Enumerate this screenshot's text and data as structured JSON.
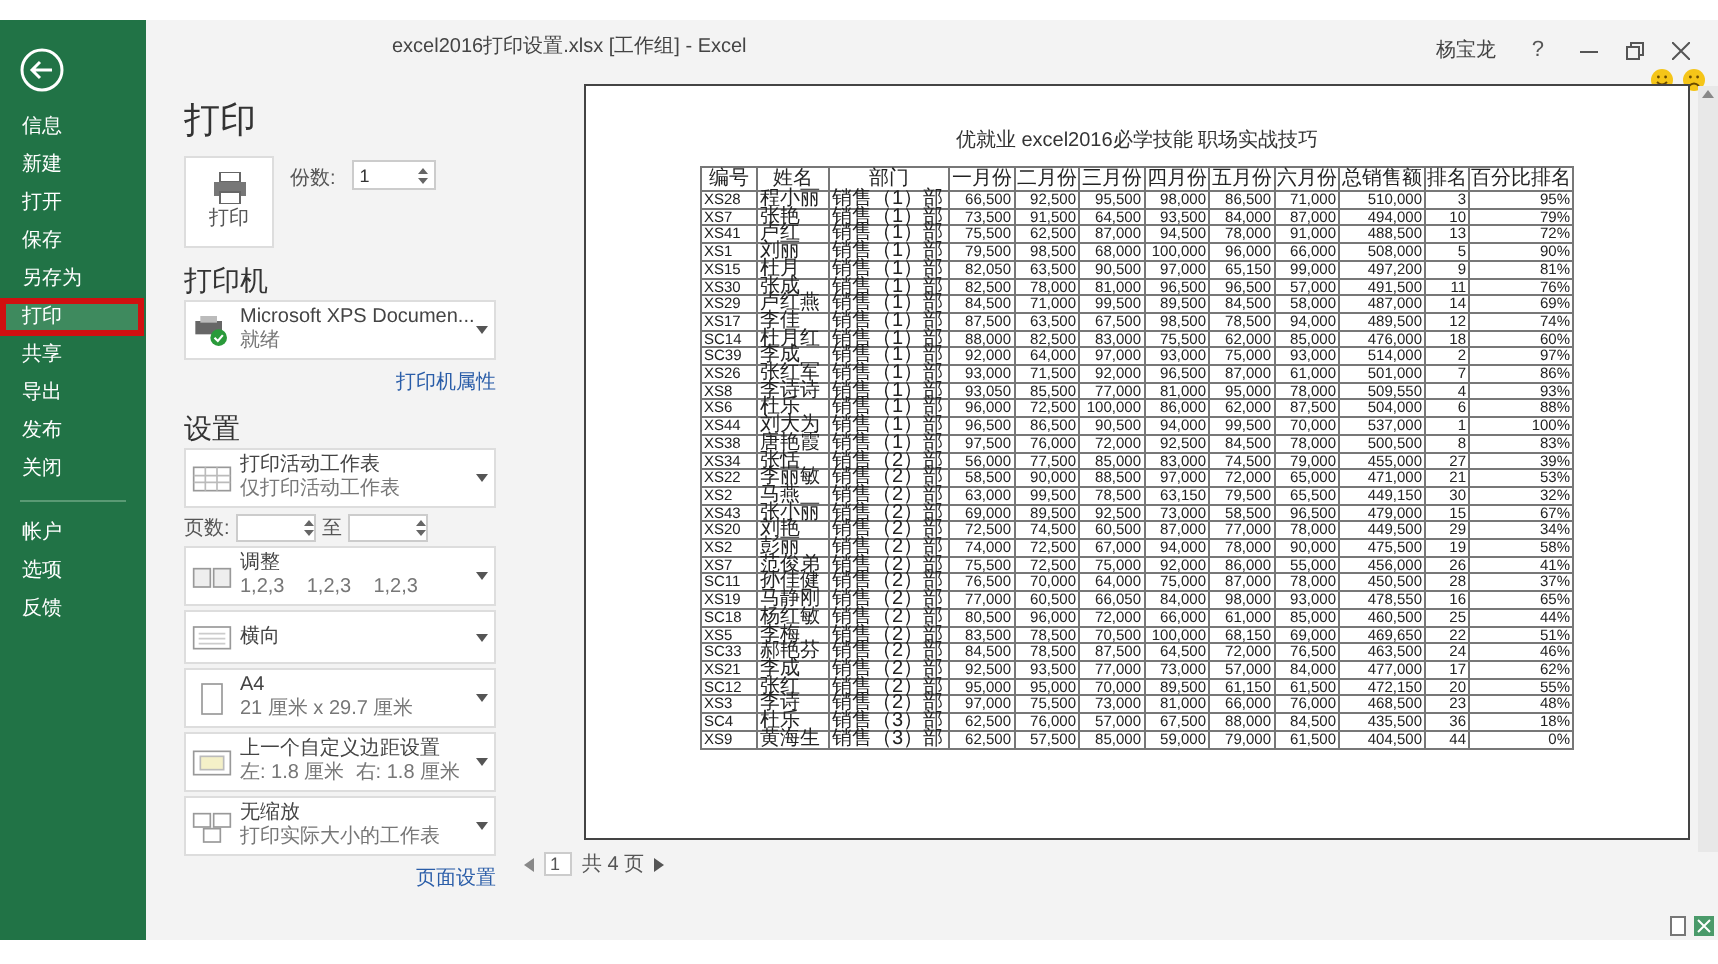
{
  "window": {
    "title": "excel2016打印设置.xlsx  [工作组] - Excel",
    "user": "杨宝龙",
    "help": "?"
  },
  "sidebar": {
    "items": [
      {
        "label": "信息",
        "selected": false
      },
      {
        "label": "新建",
        "selected": false
      },
      {
        "label": "打开",
        "selected": false
      },
      {
        "label": "保存",
        "selected": false
      },
      {
        "label": "另存为",
        "selected": false
      },
      {
        "label": "打印",
        "selected": true
      },
      {
        "label": "共享",
        "selected": false
      },
      {
        "label": "导出",
        "selected": false
      },
      {
        "label": "发布",
        "selected": false
      },
      {
        "label": "关闭",
        "selected": false
      }
    ],
    "footer_items": [
      {
        "label": "帐户",
        "selected": false
      },
      {
        "label": "选项",
        "selected": false
      },
      {
        "label": "反馈",
        "selected": false
      }
    ]
  },
  "print": {
    "heading": "打印",
    "print_button": "打印",
    "copies_label": "份数:",
    "copies": "1"
  },
  "printer": {
    "heading": "打印机",
    "name": "Microsoft XPS Documen...",
    "status": "就绪",
    "properties_link": "打印机属性"
  },
  "settings": {
    "heading": "设置",
    "options": [
      {
        "kind": "sheets",
        "title": "打印活动工作表",
        "subtitle": "仅打印活动工作表"
      },
      {
        "kind": "pages",
        "label": "页数:",
        "to_label": "至"
      },
      {
        "kind": "collate",
        "title": "调整",
        "subtitle": "1,2,3    1,2,3    1,2,3"
      },
      {
        "kind": "orientation",
        "title": "横向"
      },
      {
        "kind": "paper",
        "title": "A4",
        "subtitle": "21 厘米 x 29.7 厘米"
      },
      {
        "kind": "margins",
        "title": "上一个自定义边距设置",
        "subtitle": "左: 1.8 厘米  右: 1.8 厘米"
      },
      {
        "kind": "scaling",
        "title": "无缩放",
        "subtitle": "打印实际大小的工作表"
      }
    ],
    "page_setup_link": "页面设置"
  },
  "preview": {
    "title": "优就业 excel2016必学技能 职场实战技巧",
    "table": {
      "columns": [
        "编号",
        "姓名",
        "部门",
        "一月份",
        "二月份",
        "三月份",
        "四月份",
        "五月份",
        "六月份",
        "总销售额",
        "排名",
        "百分比排名"
      ],
      "rows": [
        [
          "XS28",
          "程小丽",
          "销售（1）部",
          "66,500",
          "92,500",
          "95,500",
          "98,000",
          "86,500",
          "71,000",
          "510,000",
          "3",
          "95%"
        ],
        [
          "XS7",
          "张艳",
          "销售（1）部",
          "73,500",
          "91,500",
          "64,500",
          "93,500",
          "84,000",
          "87,000",
          "494,000",
          "10",
          "79%"
        ],
        [
          "XS41",
          "卢红",
          "销售（1）部",
          "75,500",
          "62,500",
          "87,000",
          "94,500",
          "78,000",
          "91,000",
          "488,500",
          "13",
          "72%"
        ],
        [
          "XS1",
          "刘丽",
          "销售（1）部",
          "79,500",
          "98,500",
          "68,000",
          "100,000",
          "96,000",
          "66,000",
          "508,000",
          "5",
          "90%"
        ],
        [
          "XS15",
          "杜月",
          "销售（1）部",
          "82,050",
          "63,500",
          "90,500",
          "97,000",
          "65,150",
          "99,000",
          "497,200",
          "9",
          "81%"
        ],
        [
          "XS30",
          "张成",
          "销售（1）部",
          "82,500",
          "78,000",
          "81,000",
          "96,500",
          "96,500",
          "57,000",
          "491,500",
          "11",
          "76%"
        ],
        [
          "XS29",
          "卢红燕",
          "销售（1）部",
          "84,500",
          "71,000",
          "99,500",
          "89,500",
          "84,500",
          "58,000",
          "487,000",
          "14",
          "69%"
        ],
        [
          "XS17",
          "李佳",
          "销售（1）部",
          "87,500",
          "63,500",
          "67,500",
          "98,500",
          "78,500",
          "94,000",
          "489,500",
          "12",
          "74%"
        ],
        [
          "SC14",
          "杜月红",
          "销售（1）部",
          "88,000",
          "82,500",
          "83,000",
          "75,500",
          "62,000",
          "85,000",
          "476,000",
          "18",
          "60%"
        ],
        [
          "SC39",
          "李成",
          "销售（1）部",
          "92,000",
          "64,000",
          "97,000",
          "93,000",
          "75,000",
          "93,000",
          "514,000",
          "2",
          "97%"
        ],
        [
          "XS26",
          "张红军",
          "销售（1）部",
          "93,000",
          "71,500",
          "92,000",
          "96,500",
          "87,000",
          "61,000",
          "501,000",
          "7",
          "86%"
        ],
        [
          "XS8",
          "李诗诗",
          "销售（1）部",
          "93,050",
          "85,500",
          "77,000",
          "81,000",
          "95,000",
          "78,000",
          "509,550",
          "4",
          "93%"
        ],
        [
          "XS6",
          "杜乐",
          "销售（1）部",
          "96,000",
          "72,500",
          "100,000",
          "86,000",
          "62,000",
          "87,500",
          "504,000",
          "6",
          "88%"
        ],
        [
          "XS44",
          "刘大为",
          "销售（1）部",
          "96,500",
          "86,500",
          "90,500",
          "94,000",
          "99,500",
          "70,000",
          "537,000",
          "1",
          "100%"
        ],
        [
          "XS38",
          "唐艳霞",
          "销售（1）部",
          "97,500",
          "76,000",
          "72,000",
          "92,500",
          "84,500",
          "78,000",
          "500,500",
          "8",
          "83%"
        ],
        [
          "XS34",
          "张恬",
          "销售（2）部",
          "56,000",
          "77,500",
          "85,000",
          "83,000",
          "74,500",
          "79,000",
          "455,000",
          "27",
          "39%"
        ],
        [
          "XS22",
          "李丽敏",
          "销售（2）部",
          "58,500",
          "90,000",
          "88,500",
          "97,000",
          "72,000",
          "65,000",
          "471,000",
          "21",
          "53%"
        ],
        [
          "XS2",
          "马燕",
          "销售（2）部",
          "63,000",
          "99,500",
          "78,500",
          "63,150",
          "79,500",
          "65,500",
          "449,150",
          "30",
          "32%"
        ],
        [
          "XS43",
          "张小丽",
          "销售（2）部",
          "69,000",
          "89,500",
          "92,500",
          "73,000",
          "58,500",
          "96,500",
          "479,000",
          "15",
          "67%"
        ],
        [
          "XS20",
          "刘艳",
          "销售（2）部",
          "72,500",
          "74,500",
          "60,500",
          "87,000",
          "77,000",
          "78,000",
          "449,500",
          "29",
          "34%"
        ],
        [
          "XS2",
          "彭丽",
          "销售（2）部",
          "74,000",
          "72,500",
          "67,000",
          "94,000",
          "78,000",
          "90,000",
          "475,500",
          "19",
          "58%"
        ],
        [
          "XS7",
          "范俊弟",
          "销售（2）部",
          "75,500",
          "72,500",
          "75,000",
          "92,000",
          "86,000",
          "55,000",
          "456,000",
          "26",
          "41%"
        ],
        [
          "SC11",
          "孙佳健",
          "销售（2）部",
          "76,500",
          "70,000",
          "64,000",
          "75,000",
          "87,000",
          "78,000",
          "450,500",
          "28",
          "37%"
        ],
        [
          "XS19",
          "马静刚",
          "销售（2）部",
          "77,000",
          "60,500",
          "66,050",
          "84,000",
          "98,000",
          "93,000",
          "478,550",
          "16",
          "65%"
        ],
        [
          "SC18",
          "杨红敏",
          "销售（2）部",
          "80,500",
          "96,000",
          "72,000",
          "66,000",
          "61,000",
          "85,000",
          "460,500",
          "25",
          "44%"
        ],
        [
          "XS5",
          "李梅",
          "销售（2）部",
          "83,500",
          "78,500",
          "70,500",
          "100,000",
          "68,150",
          "69,000",
          "469,650",
          "22",
          "51%"
        ],
        [
          "SC33",
          "郝艳芬",
          "销售（2）部",
          "84,500",
          "78,500",
          "87,500",
          "64,500",
          "72,000",
          "76,500",
          "463,500",
          "24",
          "46%"
        ],
        [
          "XS21",
          "李成",
          "销售（2）部",
          "92,500",
          "93,500",
          "77,000",
          "73,000",
          "57,000",
          "84,000",
          "477,000",
          "17",
          "62%"
        ],
        [
          "SC12",
          "张红",
          "销售（2）部",
          "95,000",
          "95,000",
          "70,000",
          "89,500",
          "61,150",
          "61,500",
          "472,150",
          "20",
          "55%"
        ],
        [
          "XS3",
          "李诗",
          "销售（2）部",
          "97,000",
          "75,500",
          "73,000",
          "81,000",
          "66,000",
          "76,000",
          "468,500",
          "23",
          "48%"
        ],
        [
          "SC4",
          "杜乐",
          "销售（3）部",
          "62,500",
          "76,000",
          "57,000",
          "67,500",
          "88,000",
          "84,500",
          "435,500",
          "36",
          "18%"
        ],
        [
          "XS9",
          "黄海生",
          "销售（3）部",
          "62,500",
          "57,500",
          "85,000",
          "59,000",
          "79,000",
          "61,500",
          "404,500",
          "44",
          "0%"
        ]
      ]
    }
  },
  "pager": {
    "current": "1",
    "total": "共 4 页"
  }
}
